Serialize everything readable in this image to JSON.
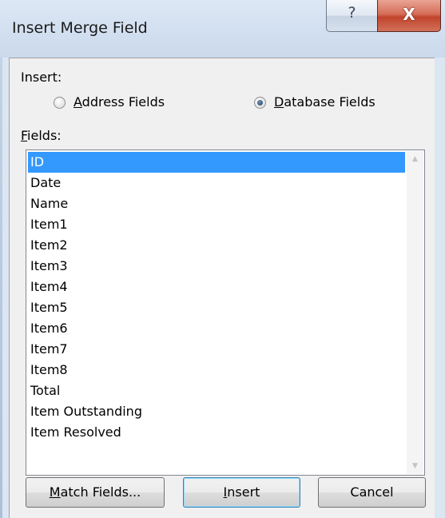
{
  "window": {
    "title": "Insert Merge Field",
    "help_glyph": "?",
    "close_glyph": "X"
  },
  "insert_group": {
    "label": "Insert:",
    "options": [
      {
        "prefix": "",
        "mnemonic": "A",
        "rest": "ddress Fields",
        "selected": false
      },
      {
        "prefix": "",
        "mnemonic": "D",
        "rest": "atabase Fields",
        "selected": true
      }
    ]
  },
  "fields": {
    "label_mnemonic": "F",
    "label_rest": "ields:",
    "items": [
      "ID",
      "Date",
      "Name",
      "Item1",
      "Item2",
      "Item3",
      "Item4",
      "Item5",
      "Item6",
      "Item7",
      "Item8",
      "Total",
      "Item Outstanding",
      "Item Resolved"
    ],
    "selected_index": 0
  },
  "buttons": {
    "match": {
      "mnemonic": "M",
      "rest": "atch Fields..."
    },
    "insert": {
      "mnemonic": "I",
      "rest": "nsert"
    },
    "cancel": {
      "label": "Cancel"
    }
  },
  "scrollbar": {
    "up_glyph": "▲",
    "down_glyph": "▼"
  },
  "colors": {
    "selection": "#3399ff",
    "titlebar": "#d3e0f0",
    "close_button": "#c2442c"
  }
}
